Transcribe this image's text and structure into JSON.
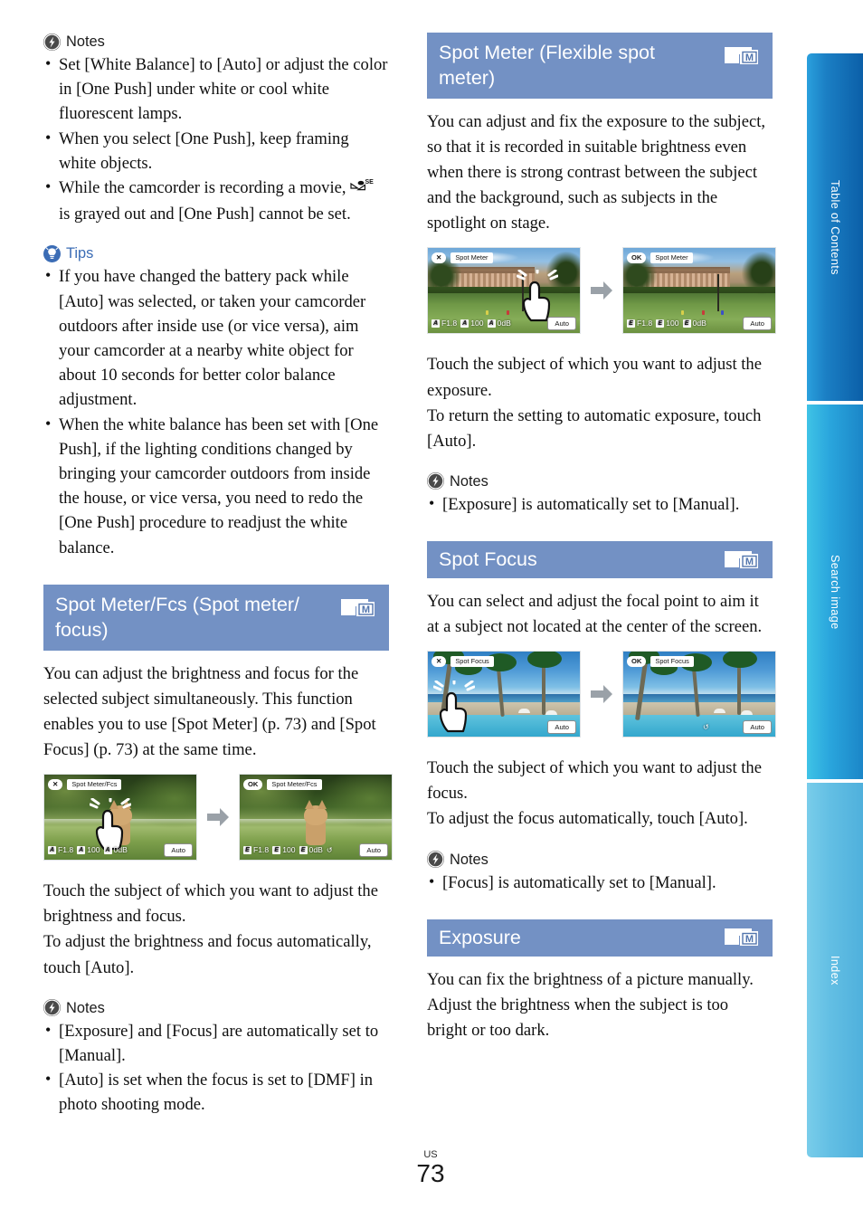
{
  "page": {
    "footer_region": "US",
    "footer_number": "73",
    "header_bar_color": "#7391c4",
    "tips_accent_color": "#3b6cb5"
  },
  "sidenav": {
    "items": [
      {
        "label": "Table of Contents",
        "name": "table-of-contents"
      },
      {
        "label": "Search image",
        "name": "search-image"
      },
      {
        "label": "Index",
        "name": "index"
      }
    ]
  },
  "left_column": {
    "notes_1": {
      "heading": "Notes",
      "items": [
        "Set [White Balance] to [Auto] or adjust the color in [One Push] under white or cool white fluorescent lamps.",
        "When you select [One Push], keep framing white objects.",
        "While the camcorder is recording a movie, is grayed out and [One Push] cannot be set."
      ],
      "item3_prefix": "While the camcorder is recording a movie,",
      "item3_suffix": "is grayed out and [One Push] cannot be set.",
      "item3_icon_label": "SET"
    },
    "tips": {
      "heading": "Tips",
      "items": [
        "If you have changed the battery pack while [Auto] was selected, or taken your camcorder outdoors after inside use (or vice versa), aim your camcorder at a nearby white object for about 10 seconds for better color balance adjustment.",
        "When the white balance has been set with [One Push], if the lighting conditions changed by bringing your camcorder outdoors from inside the house, or vice versa, you need to redo the [One Push] procedure to readjust the white balance."
      ]
    },
    "section": {
      "title": "Spot Meter/Fcs (Spot meter/ focus)",
      "badge": "M",
      "body": "You can adjust the brightness and focus for the selected subject simultaneously. This function enables you to use [Spot Meter] (p. 73) and [Spot Focus] (p. 73) at the same time.",
      "figure": {
        "before": {
          "close_button": "✕",
          "title_label": "Spot Meter/Fcs",
          "aperture": "F1.8",
          "shutter": "100",
          "gain": "0dB",
          "chip": "A",
          "auto_button": "Auto"
        },
        "after": {
          "ok_button": "OK",
          "title_label": "Spot Meter/Fcs",
          "aperture": "F1.8",
          "shutter": "100",
          "gain": "0dB",
          "chip": "E",
          "auto_button": "Auto"
        }
      },
      "after_body": "Touch the subject of which you want to adjust the brightness and focus.\nTo adjust the brightness and focus automatically, touch [Auto].",
      "after_body_line1": "Touch the subject of which you want to adjust the brightness and focus.",
      "after_body_line2": "To adjust the brightness and focus automatically, touch [Auto].",
      "notes": {
        "heading": "Notes",
        "items": [
          "[Exposure] and [Focus] are automatically set to [Manual].",
          "[Auto] is set when the focus is set to [DMF] in photo shooting mode."
        ]
      }
    }
  },
  "right_column": {
    "spot_meter": {
      "title": "Spot Meter (Flexible spot meter)",
      "badge": "M",
      "body": "You can adjust and fix the exposure to the subject, so that it is recorded in suitable brightness even when there is strong contrast between the subject and the background, such as subjects in the spotlight on stage.",
      "figure": {
        "before": {
          "close_button": "✕",
          "title_label": "Spot Meter",
          "aperture": "F1.8",
          "shutter": "100",
          "gain": "0dB",
          "chip": "A",
          "auto_button": "Auto"
        },
        "after": {
          "ok_button": "OK",
          "title_label": "Spot Meter",
          "aperture": "F1.8",
          "shutter": "100",
          "gain": "0dB",
          "chip": "E",
          "auto_button": "Auto"
        }
      },
      "after_body_line1": "Touch the subject of which you want to adjust the exposure.",
      "after_body_line2": "To return the setting to automatic exposure, touch [Auto].",
      "notes": {
        "heading": "Notes",
        "items": [
          "[Exposure] is automatically set to [Manual]."
        ]
      }
    },
    "spot_focus": {
      "title": "Spot Focus",
      "badge": "M",
      "body": "You can select and adjust the focal point to aim it at a subject not located at the center of the screen.",
      "figure": {
        "before": {
          "close_button": "✕",
          "title_label": "Spot Focus",
          "auto_button": "Auto"
        },
        "after": {
          "ok_button": "OK",
          "title_label": "Spot Focus",
          "auto_button": "Auto"
        }
      },
      "after_body_line1": "Touch the subject of which you want to adjust the focus.",
      "after_body_line2": "To adjust the focus automatically, touch [Auto].",
      "notes": {
        "heading": "Notes",
        "items": [
          "[Focus] is automatically set to [Manual]."
        ]
      }
    },
    "exposure": {
      "title": "Exposure",
      "badge": "M",
      "body": "You can fix the brightness of a picture manually. Adjust the brightness when the subject is too bright or too dark."
    }
  }
}
